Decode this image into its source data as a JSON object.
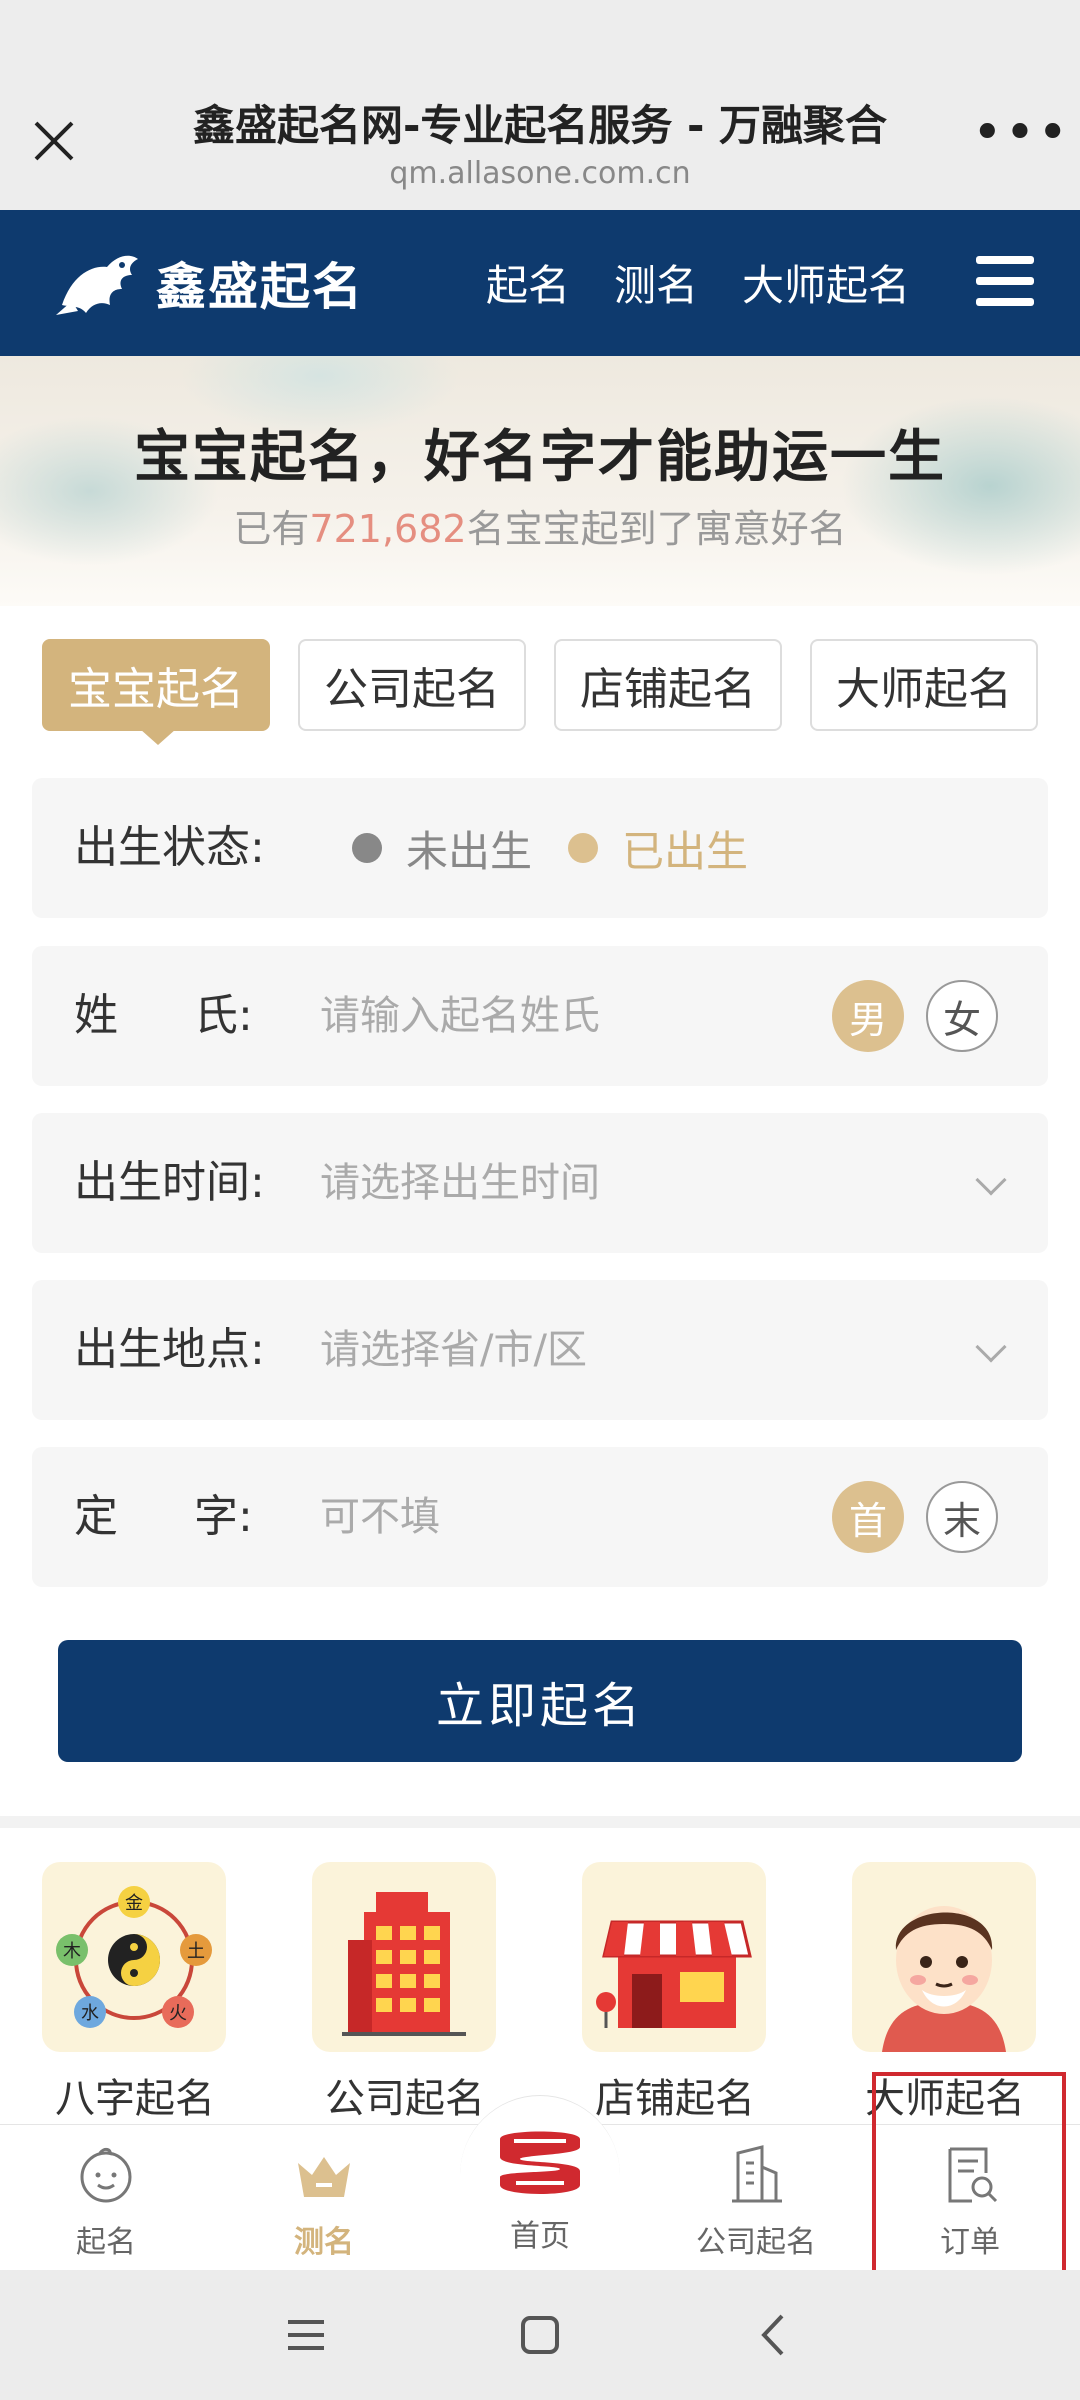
{
  "browser": {
    "title": "鑫盛起名网-专业起名服务 - 万融聚合",
    "url": "qm.allasone.com.cn",
    "more_label": "•••"
  },
  "nav": {
    "logo_text": "鑫盛起名",
    "links": [
      "起名",
      "测名",
      "大师起名"
    ]
  },
  "hero": {
    "title": "宝宝起名，好名字才能助运一生",
    "sub_prefix": "已有",
    "count": "721,682",
    "sub_suffix": "名宝宝起到了寓意好名"
  },
  "tabs": [
    {
      "label": "宝宝起名",
      "active": true
    },
    {
      "label": "公司起名",
      "active": false
    },
    {
      "label": "店铺起名",
      "active": false
    },
    {
      "label": "大师起名",
      "active": false
    }
  ],
  "form": {
    "birth_status": {
      "label": "出生状态:",
      "options": [
        "未出生",
        "已出生"
      ],
      "selected": "已出生"
    },
    "surname": {
      "label_a": "姓",
      "label_b": "氏:",
      "placeholder": "请输入起名姓氏",
      "gender_options": [
        "男",
        "女"
      ],
      "selected_gender": "男"
    },
    "birth_time": {
      "label": "出生时间:",
      "placeholder": "请选择出生时间"
    },
    "birth_place": {
      "label": "出生地点:",
      "placeholder": "请选择省/市/区"
    },
    "fixed_char": {
      "label_a": "定",
      "label_b": "字:",
      "placeholder": "可不填",
      "position_options": [
        "首",
        "末"
      ],
      "selected_position": "首"
    },
    "submit_label": "立即起名"
  },
  "features": [
    {
      "label": "八字起名",
      "icon": "bazi-wuxing-icon"
    },
    {
      "label": "公司起名",
      "icon": "building-icon"
    },
    {
      "label": "店铺起名",
      "icon": "shop-icon"
    },
    {
      "label": "大师起名",
      "icon": "master-avatar-icon"
    }
  ],
  "wuxing": [
    "金",
    "木",
    "土",
    "水",
    "火"
  ],
  "tabbar": [
    {
      "label": "起名",
      "icon": "baby-face-icon",
      "active": false
    },
    {
      "label": "测名",
      "icon": "crown-icon",
      "active": true
    },
    {
      "label": "首页",
      "icon": "home-logo-icon",
      "active": false
    },
    {
      "label": "公司起名",
      "icon": "building-outline-icon",
      "active": false
    },
    {
      "label": "订单",
      "icon": "order-search-icon",
      "active": false
    }
  ],
  "colors": {
    "navy": "#0e3a6e",
    "gold": "#d3b47d",
    "highlight": "#d0292f",
    "count_red": "#e58e80"
  }
}
